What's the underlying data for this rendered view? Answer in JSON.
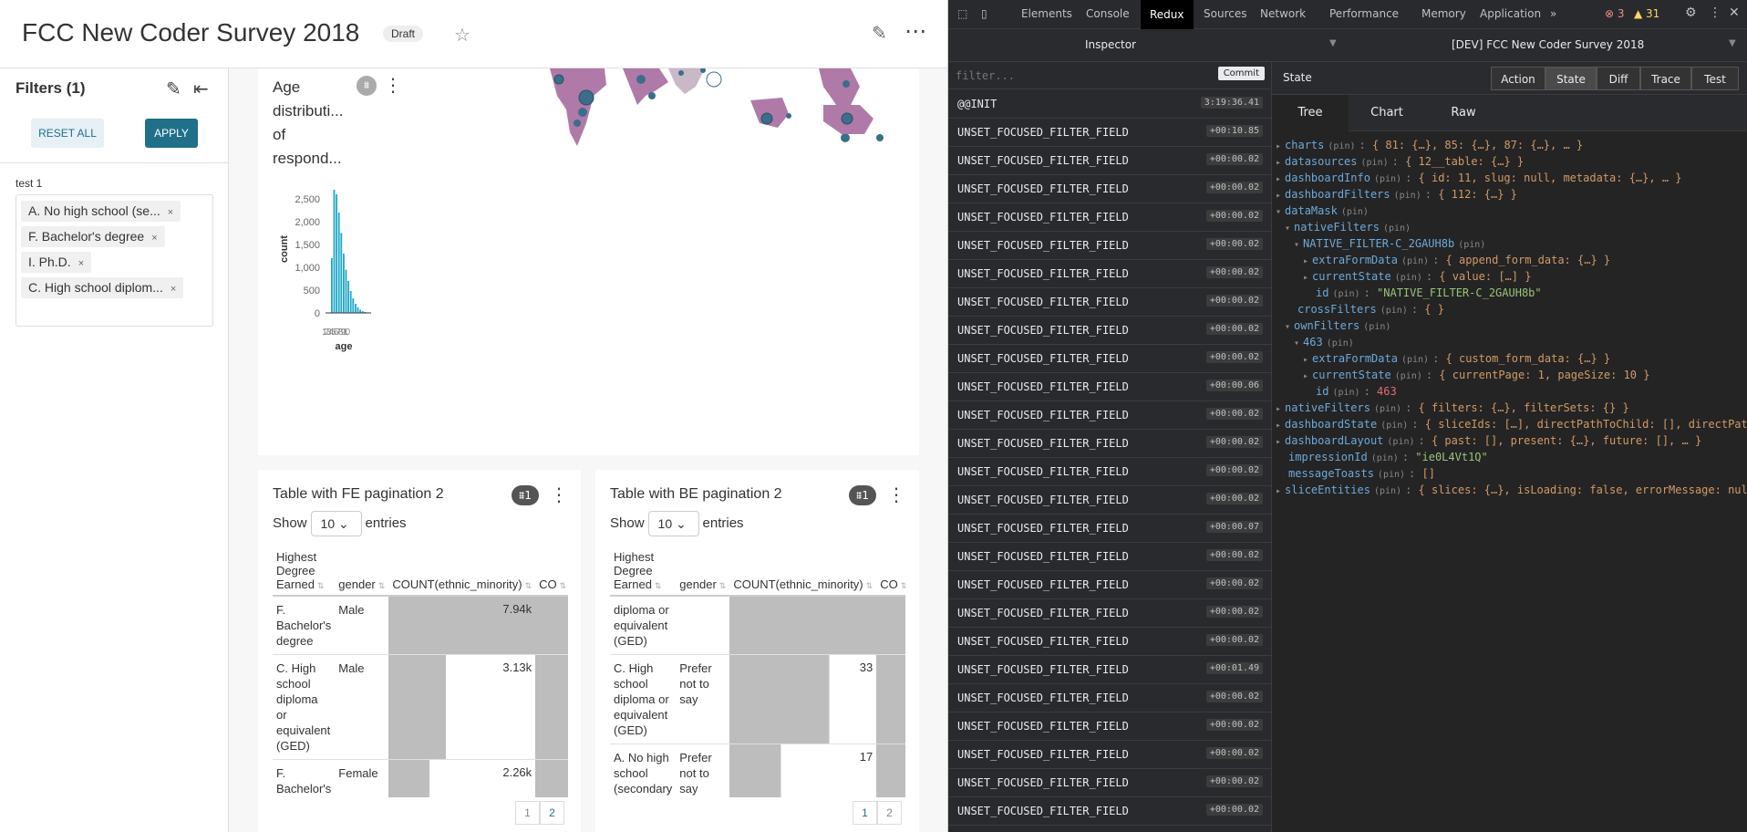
{
  "dashboard": {
    "title": "FCC New Coder Survey 2018",
    "status": "Draft",
    "star_icon": "☆",
    "edit_icon": "✎",
    "more_icon": "⋯"
  },
  "filter_bar": {
    "title": "Filters (1)",
    "reset_label": "RESET ALL",
    "apply_label": "APPLY",
    "filter_name": "test 1",
    "selected_values": [
      "A. No high school (se...",
      "F. Bachelor's degree",
      "I. Ph.D.",
      "C. High school diplom..."
    ],
    "remove_icon": "×"
  },
  "age_chart": {
    "title_lines": [
      "Age",
      "distributi...",
      "of",
      "respond..."
    ],
    "chart_data": {
      "type": "bar",
      "xlabel": "age",
      "ylabel": "count",
      "yticks": [
        "2,500",
        "2,000",
        "1,500",
        "1,000",
        "500",
        "0"
      ],
      "ylim": [
        0,
        2800
      ],
      "xtick_labels_overlapped": "12345678910",
      "values": [
        1200,
        2700,
        2600,
        2200,
        1750,
        1300,
        950,
        700,
        480,
        320,
        200,
        120,
        70,
        40,
        20,
        10,
        5
      ]
    }
  },
  "table_fe": {
    "title": "Table with FE pagination 2",
    "filter_badge": "1",
    "show_label": "Show",
    "page_size": "10",
    "entries_label": "entries",
    "columns": [
      "Highest Degree Earned",
      "gender",
      "COUNT(ethnic_minority)",
      "CO"
    ],
    "rows": [
      {
        "degree": "F. Bachelor's degree",
        "gender": "Male",
        "count": "7.94k",
        "frac": 1.0
      },
      {
        "degree": "C. High school diploma or equivalent (GED)",
        "gender": "Male",
        "count": "3.13k",
        "frac": 0.39
      },
      {
        "degree": "F. Bachelor's degree",
        "gender": "Female",
        "count": "2.26k",
        "frac": 0.28
      }
    ],
    "pages": [
      "1",
      "2"
    ],
    "active_page": "2"
  },
  "table_be": {
    "title": "Table with BE pagination 2",
    "filter_badge": "1",
    "show_label": "Show",
    "page_size": "10",
    "entries_label": "entries",
    "columns": [
      "Highest Degree Earned",
      "gender",
      "COUNT(ethnic_minority)",
      "CO"
    ],
    "rows": [
      {
        "degree": "diploma or equivalent (GED)",
        "gender": "",
        "count": "",
        "frac": 1.0
      },
      {
        "degree": "C. High school diploma or equivalent (GED)",
        "gender": "Prefer not to say",
        "count": "33",
        "frac": 0.68
      },
      {
        "degree": "A. No high school (secondary school)",
        "gender": "Prefer not to say",
        "count": "17",
        "frac": 0.35
      }
    ],
    "pages": [
      "1",
      "2"
    ],
    "active_page": "1"
  },
  "devtools": {
    "tabs": [
      "Elements",
      "Console",
      "Redux",
      "Sources",
      "Network",
      "Performance",
      "Memory",
      "Application"
    ],
    "active_tab": "Redux",
    "overflow": "»",
    "errors": "3",
    "warnings": "31",
    "inspector_label": "Inspector",
    "instance_label": "[DEV] FCC New Coder Survey 2018",
    "filter_placeholder": "filter...",
    "commit_label": "Commit",
    "state_label": "State",
    "mode_buttons": [
      "Action",
      "State",
      "Diff",
      "Trace",
      "Test"
    ],
    "active_mode": "State",
    "view_tabs": [
      "Tree",
      "Chart",
      "Raw"
    ],
    "active_view": "Tree",
    "actions": [
      {
        "name": "@@INIT",
        "time": "3:19:36.41"
      },
      {
        "name": "UNSET_FOCUSED_FILTER_FIELD",
        "time": "+00:10.85"
      },
      {
        "name": "UNSET_FOCUSED_FILTER_FIELD",
        "time": "+00:00.02"
      },
      {
        "name": "UNSET_FOCUSED_FILTER_FIELD",
        "time": "+00:00.02"
      },
      {
        "name": "UNSET_FOCUSED_FILTER_FIELD",
        "time": "+00:00.02"
      },
      {
        "name": "UNSET_FOCUSED_FILTER_FIELD",
        "time": "+00:00.02"
      },
      {
        "name": "UNSET_FOCUSED_FILTER_FIELD",
        "time": "+00:00.02"
      },
      {
        "name": "UNSET_FOCUSED_FILTER_FIELD",
        "time": "+00:00.02"
      },
      {
        "name": "UNSET_FOCUSED_FILTER_FIELD",
        "time": "+00:00.02"
      },
      {
        "name": "UNSET_FOCUSED_FILTER_FIELD",
        "time": "+00:00.02"
      },
      {
        "name": "UNSET_FOCUSED_FILTER_FIELD",
        "time": "+00:00.06"
      },
      {
        "name": "UNSET_FOCUSED_FILTER_FIELD",
        "time": "+00:00.02"
      },
      {
        "name": "UNSET_FOCUSED_FILTER_FIELD",
        "time": "+00:00.02"
      },
      {
        "name": "UNSET_FOCUSED_FILTER_FIELD",
        "time": "+00:00.02"
      },
      {
        "name": "UNSET_FOCUSED_FILTER_FIELD",
        "time": "+00:00.02"
      },
      {
        "name": "UNSET_FOCUSED_FILTER_FIELD",
        "time": "+00:00.07"
      },
      {
        "name": "UNSET_FOCUSED_FILTER_FIELD",
        "time": "+00:00.02"
      },
      {
        "name": "UNSET_FOCUSED_FILTER_FIELD",
        "time": "+00:00.02"
      },
      {
        "name": "UNSET_FOCUSED_FILTER_FIELD",
        "time": "+00:00.02"
      },
      {
        "name": "UNSET_FOCUSED_FILTER_FIELD",
        "time": "+00:00.02"
      },
      {
        "name": "UNSET_FOCUSED_FILTER_FIELD",
        "time": "+00:01.49"
      },
      {
        "name": "UNSET_FOCUSED_FILTER_FIELD",
        "time": "+00:00.02"
      },
      {
        "name": "UNSET_FOCUSED_FILTER_FIELD",
        "time": "+00:00.02"
      },
      {
        "name": "UNSET_FOCUSED_FILTER_FIELD",
        "time": "+00:00.02"
      },
      {
        "name": "UNSET_FOCUSED_FILTER_FIELD",
        "time": "+00:00.02"
      },
      {
        "name": "UNSET_FOCUSED_FILTER_FIELD",
        "time": "+00:00.02"
      }
    ],
    "state_tree": [
      {
        "indent": 0,
        "arrow": "▸",
        "key": "charts",
        "val": "{ 81: {…}, 85: {…}, 87: {…}, … }",
        "cls": "v"
      },
      {
        "indent": 0,
        "arrow": "▸",
        "key": "datasources",
        "val": "{ 12__table: {…} }",
        "cls": "v"
      },
      {
        "indent": 0,
        "arrow": "▸",
        "key": "dashboardInfo",
        "val": "{ id: 11, slug: null, metadata: {…}, … }",
        "cls": "v"
      },
      {
        "indent": 0,
        "arrow": "▸",
        "key": "dashboardFilters",
        "val": "{ 112: {…} }",
        "cls": "v"
      },
      {
        "indent": 0,
        "arrow": "▾",
        "key": "dataMask",
        "val": "",
        "cls": "v"
      },
      {
        "indent": 1,
        "arrow": "▾",
        "key": "nativeFilters",
        "val": "",
        "cls": "v"
      },
      {
        "indent": 2,
        "arrow": "▾",
        "key": "NATIVE_FILTER-C_2GAUH8b",
        "val": "",
        "cls": "v"
      },
      {
        "indent": 3,
        "arrow": "▸",
        "key": "extraFormData",
        "val": "{ append_form_data: {…} }",
        "cls": "v"
      },
      {
        "indent": 3,
        "arrow": "▸",
        "key": "currentState",
        "val": "{ value: […] }",
        "cls": "v"
      },
      {
        "indent": 3,
        "arrow": "",
        "key": "id",
        "val": "\"NATIVE_FILTER-C_2GAUH8b\"",
        "cls": "s"
      },
      {
        "indent": 1,
        "arrow": "",
        "key": "crossFilters",
        "val": "{ }",
        "cls": "v"
      },
      {
        "indent": 1,
        "arrow": "▾",
        "key": "ownFilters",
        "val": "",
        "cls": "v"
      },
      {
        "indent": 2,
        "arrow": "▾",
        "key": "463",
        "val": "",
        "cls": "v"
      },
      {
        "indent": 3,
        "arrow": "▸",
        "key": "extraFormData",
        "val": "{ custom_form_data: {…} }",
        "cls": "v"
      },
      {
        "indent": 3,
        "arrow": "▸",
        "key": "currentState",
        "val": "{ currentPage: 1, pageSize: 10 }",
        "cls": "v"
      },
      {
        "indent": 3,
        "arrow": "",
        "key": "id",
        "val": "463",
        "cls": "n"
      },
      {
        "indent": 0,
        "arrow": "▸",
        "key": "nativeFilters",
        "val": "{ filters: {…}, filterSets: {} }",
        "cls": "v"
      },
      {
        "indent": 0,
        "arrow": "▸",
        "key": "dashboardState",
        "val": "{ sliceIds: […], directPathToChild: [], directPathL",
        "cls": "v"
      },
      {
        "indent": 0,
        "arrow": "▸",
        "key": "dashboardLayout",
        "val": "{ past: [], present: {…}, future: [], … }",
        "cls": "v"
      },
      {
        "indent": 0,
        "arrow": "",
        "key": "impressionId",
        "val": "\"ie0L4Vt1Q\"",
        "cls": "s"
      },
      {
        "indent": 0,
        "arrow": "",
        "key": "messageToasts",
        "val": "[]",
        "cls": "v"
      },
      {
        "indent": 0,
        "arrow": "▸",
        "key": "sliceEntities",
        "val": "{ slices: {…}, isLoading: false, errorMessage: null,",
        "cls": "v"
      }
    ],
    "pin_label": "(pin)"
  }
}
